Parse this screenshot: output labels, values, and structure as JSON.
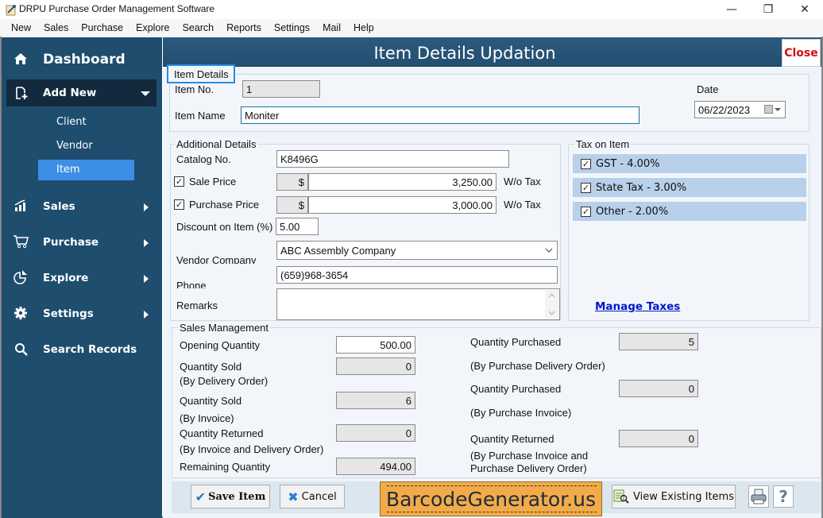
{
  "window": {
    "title": "DRPU Purchase Order Management Software",
    "controls": {
      "minimize": "—",
      "maximize": "❐",
      "close": "✕"
    }
  },
  "menu": [
    "New",
    "Sales",
    "Purchase",
    "Explore",
    "Search",
    "Reports",
    "Settings",
    "Mail",
    "Help"
  ],
  "sidebar": {
    "dashboard": "Dashboard",
    "add_new": "Add New",
    "sub_items": [
      "Client",
      "Vendor",
      "Item"
    ],
    "active_sub": "Item",
    "items": [
      {
        "label": "Sales",
        "icon": "chart-icon"
      },
      {
        "label": "Purchase",
        "icon": "cart-icon"
      },
      {
        "label": "Explore",
        "icon": "pie-icon"
      },
      {
        "label": "Settings",
        "icon": "gear-icon"
      },
      {
        "label": "Search Records",
        "icon": "search-icon"
      }
    ]
  },
  "header": {
    "title": "Item Details Updation",
    "close_label": "Close"
  },
  "item_details": {
    "group_label": "Item Details",
    "item_no_label": "Item No.",
    "item_no": "1",
    "item_name_label": "Item Name",
    "item_name": "Moniter",
    "date_label": "Date",
    "date": "06/22/2023"
  },
  "additional": {
    "group_label": "Additional Details",
    "catalog_label": "Catalog No.",
    "catalog": "K8496G",
    "sale_price_label": "Sale Price",
    "sale_price_checked": true,
    "currency": "$",
    "sale_price": "3,250.00",
    "wo_tax": "W/o Tax",
    "purchase_price_label": "Purchase Price",
    "purchase_price_checked": true,
    "purchase_price": "3,000.00",
    "discount_label": "Discount on Item (%)",
    "discount": "5.00",
    "vendor_label": "Vendor Company",
    "vendor": "ABC Assembly Company",
    "phone_label": "Phone",
    "phone": "(659)968-3654",
    "remarks_label": "Remarks",
    "remarks": ""
  },
  "tax": {
    "group_label": "Tax on Item",
    "items": [
      {
        "label": "GST - 4.00%",
        "checked": true
      },
      {
        "label": "State Tax - 3.00%",
        "checked": true
      },
      {
        "label": "Other - 2.00%",
        "checked": true
      }
    ],
    "manage_link": "Manage Taxes"
  },
  "sales_mgmt": {
    "group_label": "Sales Management",
    "opening_qty_label": "Opening Quantity",
    "opening_qty": "500.00",
    "sold_do_label": "Quantity Sold",
    "sold_do_sub": "(By Delivery Order)",
    "sold_do": "0",
    "sold_inv_label": "Quantity Sold",
    "sold_inv_sub": "(By Invoice)",
    "sold_inv": "6",
    "returned_label": "Quantity Returned",
    "returned_sub": "(By Invoice and Delivery Order)",
    "returned": "0",
    "remaining_label": "Remaining Quantity",
    "remaining": "494.00",
    "purch_pdo_label": "Quantity Purchased",
    "purch_pdo_sub": "(By Purchase Delivery Order)",
    "purch_pdo": "5",
    "purch_pi_label": "Quantity Purchased",
    "purch_pi_sub": "(By Purchase Invoice)",
    "purch_pi": "0",
    "purch_ret_label": "Quantity Returned",
    "purch_ret_sub1": "(By Purchase Invoice and",
    "purch_ret_sub2": "Purchase Delivery Order)",
    "purch_ret": "0"
  },
  "footer": {
    "save_label": "Save Item",
    "cancel_label": "Cancel",
    "watermark": "BarcodeGenerator.us",
    "view_label": "View Existing Items"
  }
}
